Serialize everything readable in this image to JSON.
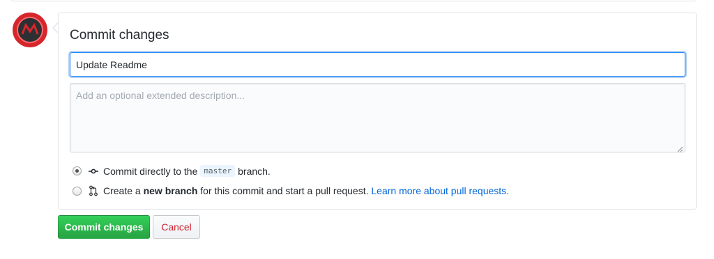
{
  "avatar": {
    "icon": "logo-mountain-icon",
    "ring_color": "#d7262b",
    "bg_color": "#2e2f33"
  },
  "panel": {
    "title": "Commit changes",
    "summary_value": "Update Readme",
    "description_placeholder": "Add an optional extended description..."
  },
  "options": {
    "direct": {
      "selected": true,
      "icon": "git-commit-icon",
      "prefix": "Commit directly to the",
      "branch": "master",
      "suffix": "branch."
    },
    "new_branch": {
      "selected": false,
      "icon": "git-pull-request-icon",
      "prefix": "Create a",
      "bold": "new branch",
      "suffix": "for this commit and start a pull request.",
      "link": "Learn more about pull requests."
    }
  },
  "buttons": {
    "commit_label": "Commit changes",
    "cancel_label": "Cancel"
  },
  "colors": {
    "primary_green": "#28a745",
    "link_blue": "#0366d6",
    "cancel_red": "#cb2431",
    "focus_blue": "#2188ff"
  }
}
